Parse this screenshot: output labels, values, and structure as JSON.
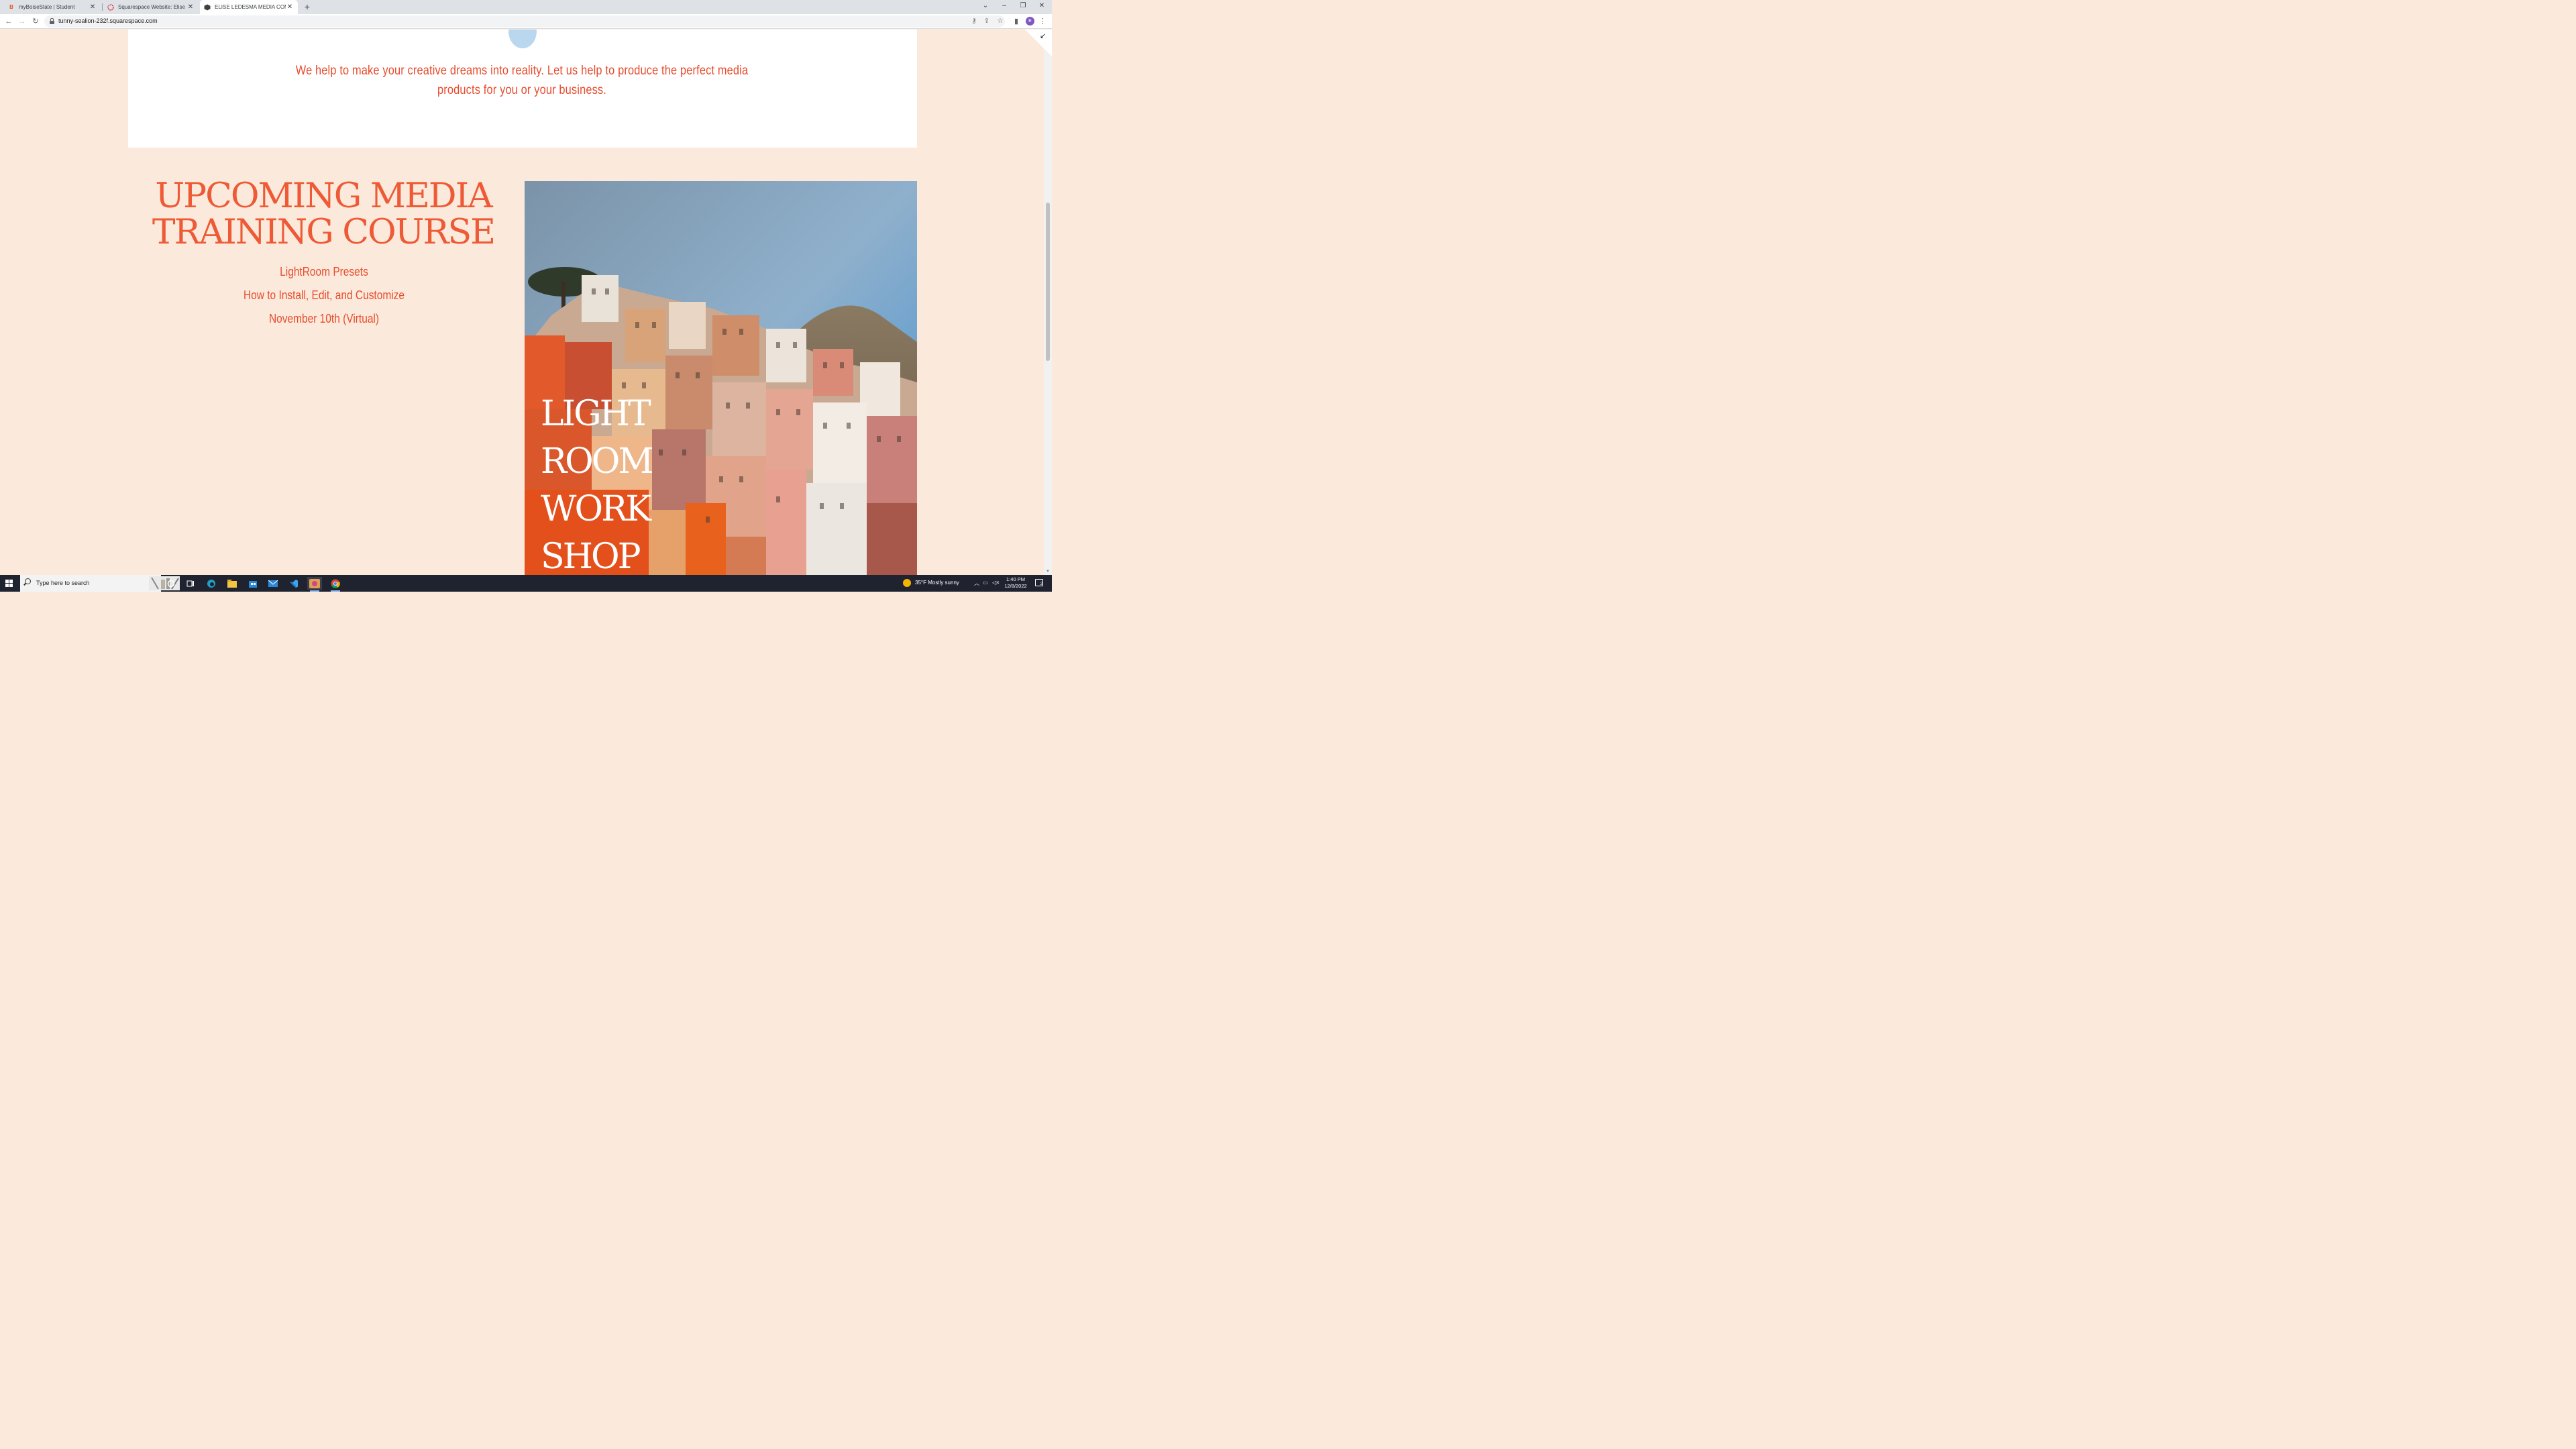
{
  "browser": {
    "tabs": [
      {
        "title": "myBoiseState | Student",
        "favicon": "boise-state-icon",
        "active": false
      },
      {
        "title": "Squarespace Website: Elise Ledesma",
        "favicon": "squarespace-icon",
        "active": false
      },
      {
        "title": "ELISE LEDESMA MEDIA COMPANY",
        "favicon": "site-cube-icon",
        "active": true
      }
    ],
    "url": "tunny-sealion-232f.squarespace.com",
    "profile_initial": "E",
    "new_tab_symbol": "+"
  },
  "page": {
    "tagline": "We help to make your creative dreams into reality. Let us help to produce the perfect media products for you or your business.",
    "course": {
      "title_line1": "UPCOMING MEDIA",
      "title_line2": "TRAINING COURSE",
      "lines": [
        "LightRoom Presets",
        "How to Install, Edit, and Customize",
        "November 10th (Virtual)"
      ]
    },
    "photo_title": [
      "LIGHT",
      "ROOM",
      "WORK",
      "SHOP"
    ],
    "colors": {
      "accent": "#ef5a36",
      "background": "#fbeadc",
      "card": "#ffffff",
      "blob": "#b9d7ee"
    }
  },
  "taskbar": {
    "search_placeholder": "Type here to search",
    "weather": "35°F  Mostly sunny",
    "time": "1:40 PM",
    "date": "12/8/2022",
    "notification_count": "2"
  }
}
